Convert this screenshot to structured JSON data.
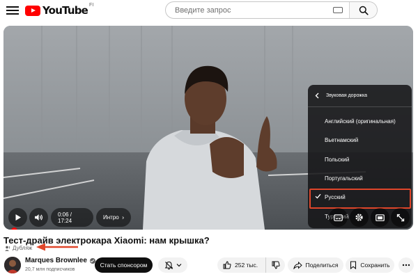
{
  "header": {
    "logo_text": "YouTube",
    "logo_region": "FI",
    "search_placeholder": "Введите запрос"
  },
  "player": {
    "time_display": "0:06 / 17:24",
    "chapter_label": "Интро",
    "progress_fraction": 0.0057,
    "audio_menu": {
      "title": "Звуковая дорожка",
      "items": [
        {
          "label": "Английский (оригинальная)",
          "selected": false
        },
        {
          "label": "Вьетнамский",
          "selected": false
        },
        {
          "label": "Польский",
          "selected": false
        },
        {
          "label": "Португальский",
          "selected": false
        },
        {
          "label": "Русский",
          "selected": true
        },
        {
          "label": "Турецкий",
          "selected": false
        }
      ]
    }
  },
  "video": {
    "title": "Тест-драйв электрокара Xiaomi: нам крышка?",
    "dub_badge": "Дубляж"
  },
  "channel": {
    "name": "Marques Brownlee",
    "subscribers": "20,7 млн подписчиков"
  },
  "actions": {
    "sponsor_label": "Стать спонсором",
    "like_count": "252 тыс.",
    "share_label": "Поделиться",
    "save_label": "Сохранить"
  },
  "colors": {
    "accent": "#ff0000",
    "highlight_box": "#e0462a"
  }
}
